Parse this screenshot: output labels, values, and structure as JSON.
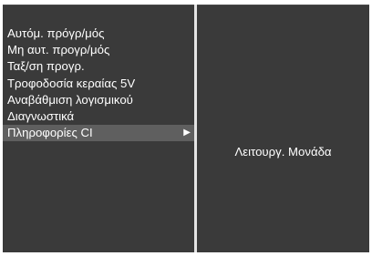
{
  "menu": {
    "items": [
      {
        "label": "Αυτόμ. πρόγρ/μός"
      },
      {
        "label": "Μη αυτ. προγρ/μός"
      },
      {
        "label": "Ταξ/ση προγρ."
      },
      {
        "label": "Τροφοδοσία κεραίας 5V"
      },
      {
        "label": "Αναβάθμιση λογισμικού"
      },
      {
        "label": "Διαγνωστικά"
      },
      {
        "label": "Πληροφορίες CI",
        "selected": true
      }
    ],
    "selected_arrow": "▶"
  },
  "submenu": {
    "item_label": "Λειτουργ. Μονάδα"
  },
  "colors": {
    "panel_background": "#3a3a3a",
    "selected_highlight": "#5f5f5f",
    "text": "#ffffff",
    "divider": "#e4e4e4"
  },
  "icons": {
    "submenu_indicator": "triangle-right-icon"
  }
}
